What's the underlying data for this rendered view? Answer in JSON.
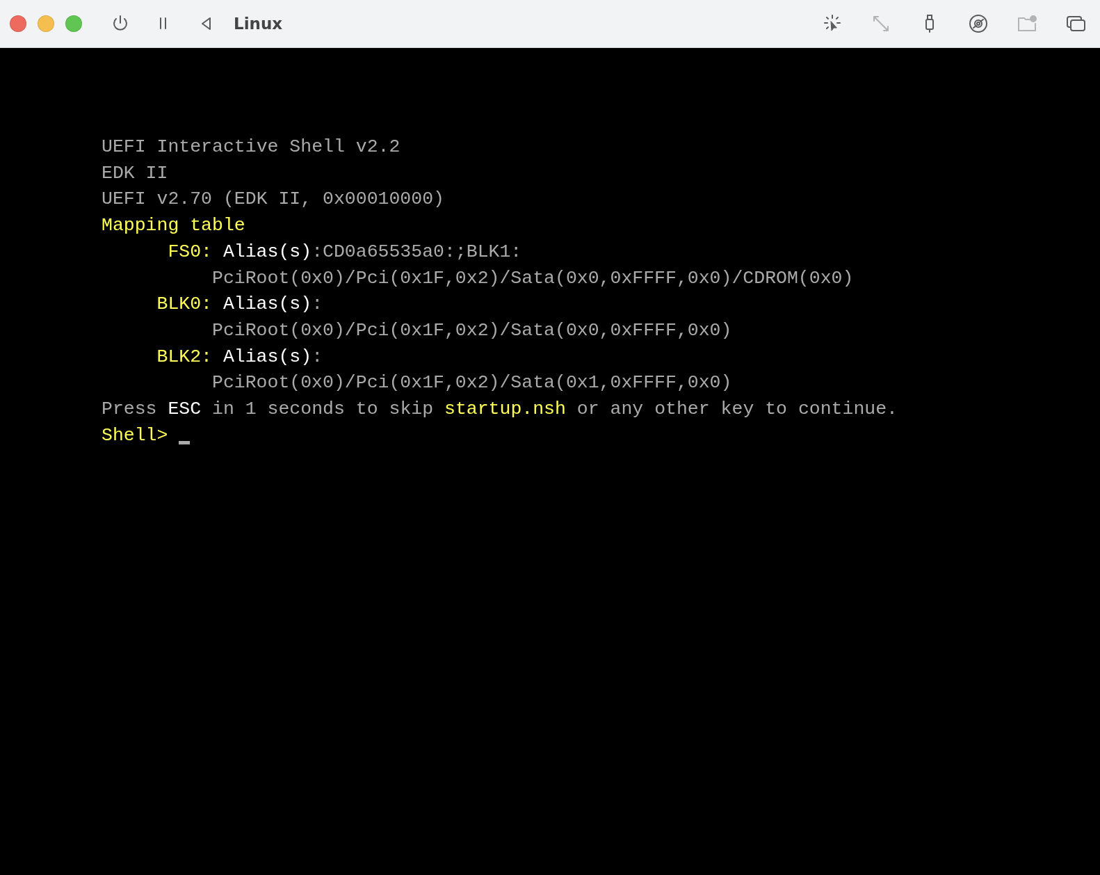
{
  "window": {
    "title": "Linux"
  },
  "toolbar_left": [
    {
      "kind": "power",
      "disabled": false
    },
    {
      "kind": "pause",
      "disabled": false
    },
    {
      "kind": "back",
      "disabled": false
    }
  ],
  "toolbar_right": [
    {
      "kind": "capture",
      "disabled": false
    },
    {
      "kind": "resize",
      "disabled": true
    },
    {
      "kind": "usb",
      "disabled": false
    },
    {
      "kind": "disc",
      "disabled": false
    },
    {
      "kind": "folder",
      "disabled": true
    },
    {
      "kind": "windows",
      "disabled": false
    }
  ],
  "console": {
    "header": [
      "UEFI Interactive Shell v2.2",
      "EDK II",
      "UEFI v2.70 (EDK II, 0x00010000)"
    ],
    "mapping_title": "Mapping table",
    "mappings": [
      {
        "name": "FS0:",
        "alias_label": "Alias(s)",
        "alias": ":CD0a65535a0:;BLK1:",
        "path": "PciRoot(0x0)/Pci(0x1F,0x2)/Sata(0x0,0xFFFF,0x0)/CDROM(0x0)"
      },
      {
        "name": "BLK0:",
        "alias_label": "Alias(s)",
        "alias": ":",
        "path": "PciRoot(0x0)/Pci(0x1F,0x2)/Sata(0x0,0xFFFF,0x0)"
      },
      {
        "name": "BLK2:",
        "alias_label": "Alias(s)",
        "alias": ":",
        "path": "PciRoot(0x0)/Pci(0x1F,0x2)/Sata(0x1,0xFFFF,0x0)"
      }
    ],
    "notice": [
      {
        "text": "Press ",
        "color": "#aaaaaa"
      },
      {
        "text": "ESC",
        "color": "#ffffff"
      },
      {
        "text": " in 1 seconds to skip ",
        "color": "#aaaaaa"
      },
      {
        "text": "startup.nsh",
        "color": "#ffff55"
      },
      {
        "text": " or any other key to continue.",
        "color": "#aaaaaa"
      }
    ],
    "prompt": "Shell>"
  }
}
